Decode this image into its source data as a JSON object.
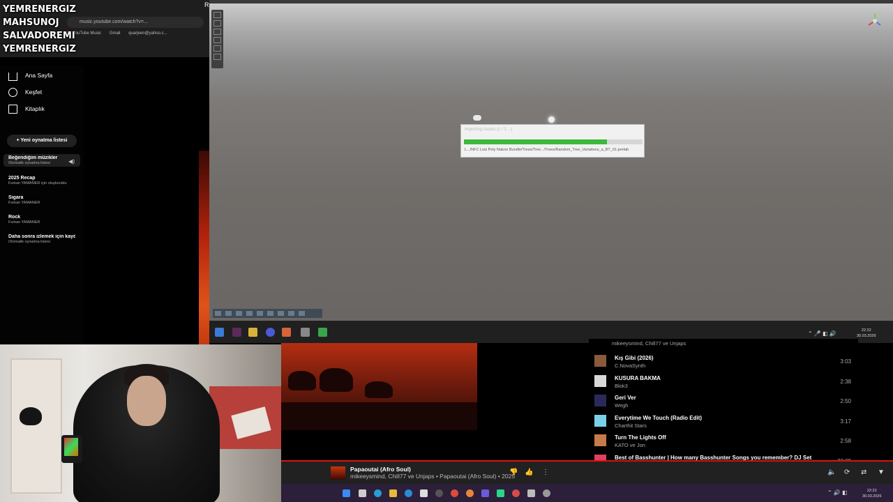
{
  "overlay": {
    "names": [
      "YEMRENERGIZ",
      "MAHSUNOJ",
      "SALVADOREMI",
      "YEMRENERGIZ"
    ]
  },
  "browser": {
    "url": "music.youtube.com/watch?v=...",
    "bookmarks": [
      "YouTube",
      "YouTube Music",
      "Gmail",
      "quarjeen@yahoo.c..."
    ],
    "corner_letter": "R"
  },
  "sidebar": {
    "nav": [
      {
        "label": "Ana Sayfa",
        "icon": "home-icon"
      },
      {
        "label": "Keşfet",
        "icon": "explore-icon"
      },
      {
        "label": "Kitaplık",
        "icon": "library-icon"
      }
    ],
    "new_playlist_label": "Yeni oynatma listesi",
    "playlists": [
      {
        "title": "Beğendiğim müzikler",
        "subtitle": "Otomatik oynatma listesi",
        "active": true
      },
      {
        "title": "2025 Recap",
        "subtitle": "Furkan YAMANER için oluşturuldu"
      },
      {
        "title": "Sigara",
        "subtitle": "Furkan YAMANER"
      },
      {
        "title": "Rock",
        "subtitle": "Furkan YAMANER"
      },
      {
        "title": "Daha sonra izlemek için kayd...",
        "subtitle": "Otomatik oynatma listesi"
      }
    ]
  },
  "editor": {
    "progress_title": "Importing Assets (1 / 2 ...)",
    "progress_fraction": 0.8,
    "progress_file": "L.../NFC Low Poly Nature Bundle/Trees/Tree.../Trees/Random_Tree_Variations_a_BT_01.prefab"
  },
  "remote_taskbar": {
    "clock_time": "22:22",
    "clock_date": "30.03.2026"
  },
  "queue": {
    "top_artist": "mikeeysmind, Chill77 ve Unjaps",
    "items": [
      {
        "title": "Kış Gibi (2026)",
        "artist": "C.NovaSynth",
        "duration": "3:03",
        "thumb_color": "#8a5a3a"
      },
      {
        "title": "KUSURA BAKMA",
        "artist": "Blok3",
        "duration": "2:38",
        "thumb_color": "#d8d8d8"
      },
      {
        "title": "Geri Ver",
        "artist": "Wegh",
        "duration": "2:50",
        "thumb_color": "#2a2a5a"
      },
      {
        "title": "Everytime We Touch (Radio Edit)",
        "artist": "Charthit Stars",
        "duration": "3:17",
        "thumb_color": "#7ad0e8"
      },
      {
        "title": "Turn The Lights Off",
        "artist": "KATO ve Jon",
        "duration": "2:58",
        "thumb_color": "#c87a4a"
      },
      {
        "title": "Best of Basshunter | How many Basshunter Songs you remember? DJ Set",
        "artist": "",
        "duration": "23:09",
        "thumb_color": "#e04060"
      }
    ]
  },
  "player": {
    "title": "Papaoutai (Afro Soul)",
    "subtitle": "mikeeysmind, Chill77 ve Unjaps • Papaoutai (Afro Soul) • 2025"
  },
  "host_taskbar": {
    "clock_time": "22:22",
    "clock_date": "30.03.2026"
  }
}
